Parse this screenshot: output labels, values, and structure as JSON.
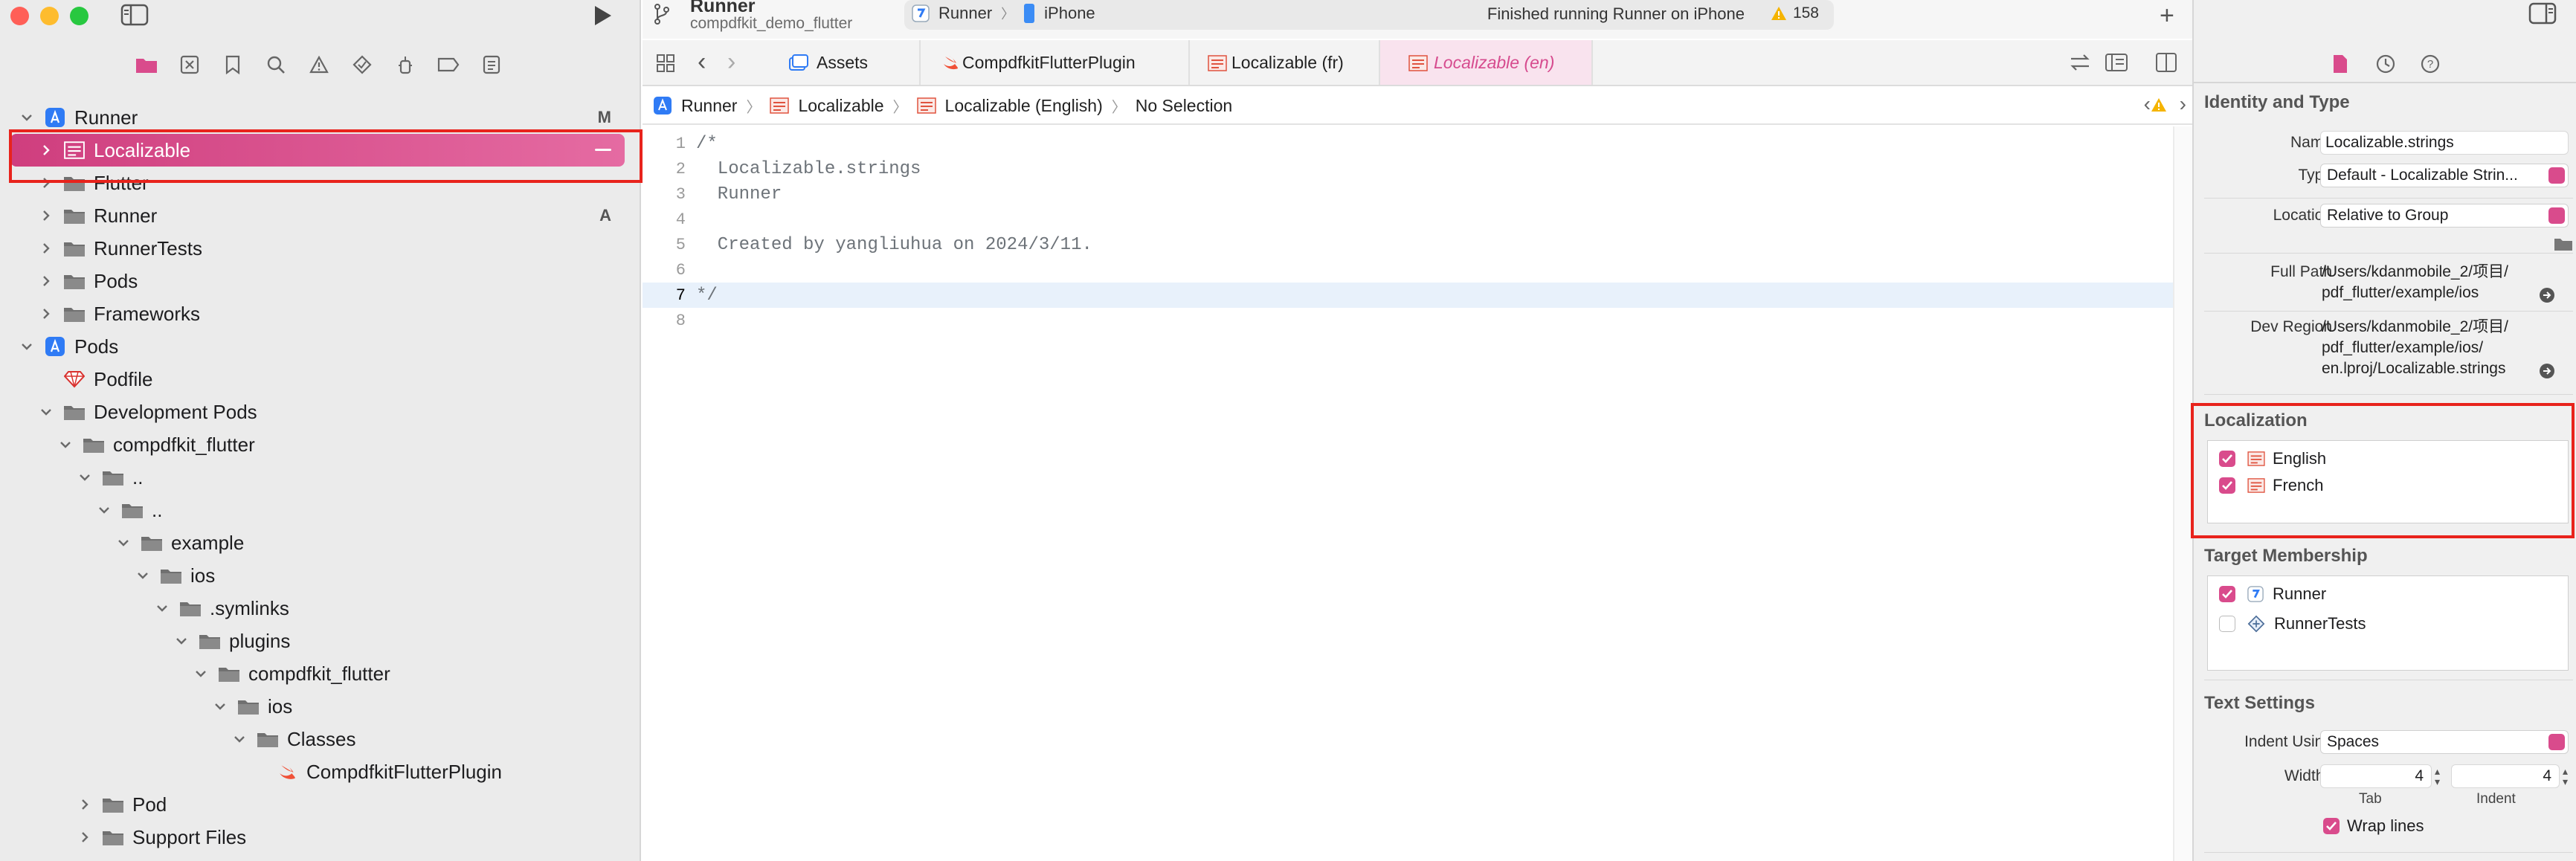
{
  "window": {
    "project_name": "Runner",
    "project_subtitle": "compdfkit_demo_flutter",
    "scheme": "Runner",
    "destination": "iPhone",
    "status": "Finished running Runner on iPhone",
    "warning_count": "158"
  },
  "navigator": {
    "rows": [
      {
        "label": "Runner",
        "badge": "M",
        "icon": "project-icon",
        "indent": 0,
        "chevron": "down"
      },
      {
        "label": "Localizable",
        "badge": "",
        "icon": "strings-file-icon",
        "indent": 1,
        "chevron": "right",
        "selected": true
      },
      {
        "label": "Flutter",
        "badge": "",
        "icon": "folder-icon",
        "indent": 1,
        "chevron": "right"
      },
      {
        "label": "Runner",
        "badge": "A",
        "icon": "folder-icon",
        "indent": 1,
        "chevron": "right"
      },
      {
        "label": "RunnerTests",
        "badge": "",
        "icon": "folder-icon",
        "indent": 1,
        "chevron": "right"
      },
      {
        "label": "Pods",
        "badge": "",
        "icon": "folder-icon",
        "indent": 1,
        "chevron": "right"
      },
      {
        "label": "Frameworks",
        "badge": "",
        "icon": "folder-icon",
        "indent": 1,
        "chevron": "right"
      },
      {
        "label": "Pods",
        "badge": "",
        "icon": "project-icon",
        "indent": 0,
        "chevron": "down"
      },
      {
        "label": "Podfile",
        "badge": "",
        "icon": "ruby-icon",
        "indent": 1,
        "chevron": "none"
      },
      {
        "label": "Development Pods",
        "badge": "",
        "icon": "folder-icon",
        "indent": 1,
        "chevron": "down"
      },
      {
        "label": "compdfkit_flutter",
        "badge": "",
        "icon": "folder-icon",
        "indent": 2,
        "chevron": "down"
      },
      {
        "label": "..",
        "badge": "",
        "icon": "folder-icon",
        "indent": 3,
        "chevron": "down"
      },
      {
        "label": "..",
        "badge": "",
        "icon": "folder-icon",
        "indent": 4,
        "chevron": "down"
      },
      {
        "label": "example",
        "badge": "",
        "icon": "folder-icon",
        "indent": 5,
        "chevron": "down"
      },
      {
        "label": "ios",
        "badge": "",
        "icon": "folder-icon",
        "indent": 6,
        "chevron": "down"
      },
      {
        "label": ".symlinks",
        "badge": "",
        "icon": "folder-icon",
        "indent": 7,
        "chevron": "down"
      },
      {
        "label": "plugins",
        "badge": "",
        "icon": "folder-icon",
        "indent": 8,
        "chevron": "down"
      },
      {
        "label": "compdfkit_flutter",
        "badge": "",
        "icon": "folder-icon",
        "indent": 9,
        "chevron": "down"
      },
      {
        "label": "ios",
        "badge": "",
        "icon": "folder-icon",
        "indent": 10,
        "chevron": "down"
      },
      {
        "label": "Classes",
        "badge": "",
        "icon": "folder-icon",
        "indent": 11,
        "chevron": "down"
      },
      {
        "label": "CompdfkitFlutterPlugin",
        "badge": "",
        "icon": "swift-icon",
        "indent": 12,
        "chevron": "none"
      },
      {
        "label": "Pod",
        "badge": "",
        "icon": "folder-icon",
        "indent": 3,
        "chevron": "right"
      },
      {
        "label": "Support Files",
        "badge": "",
        "icon": "folder-icon",
        "indent": 3,
        "chevron": "right"
      }
    ]
  },
  "editor": {
    "tabs": [
      "Assets",
      "CompdfkitFlutterPlugin",
      "Localizable (fr)",
      "Localizable (en)"
    ],
    "breadcrumb": [
      "Runner",
      "Localizable",
      "Localizable (English)",
      "No Selection"
    ],
    "lines": [
      {
        "n": "1",
        "text": "/*"
      },
      {
        "n": "2",
        "text": "  Localizable.strings"
      },
      {
        "n": "3",
        "text": "  Runner"
      },
      {
        "n": "4",
        "text": ""
      },
      {
        "n": "5",
        "text": "  Created by yangliuhua on 2024/3/11."
      },
      {
        "n": "6",
        "text": ""
      },
      {
        "n": "7",
        "text": "*/",
        "current": true
      },
      {
        "n": "8",
        "text": ""
      }
    ]
  },
  "inspector": {
    "identity_title": "Identity and Type",
    "name_label": "Name",
    "name_value": "Localizable.strings",
    "type_label": "Type",
    "type_value": "Default - Localizable Strin...",
    "location_label": "Location",
    "location_value": "Relative to Group",
    "fullpath_label": "Full Path",
    "fullpath_line1": "/Users/kdanmobile_2/项目/",
    "fullpath_line2": "pdf_flutter/example/ios",
    "devregion_label": "Dev Region",
    "devregion_line1": "/Users/kdanmobile_2/项目/",
    "devregion_line2": "pdf_flutter/example/ios/",
    "devregion_line3": "en.lproj/Localizable.strings",
    "localization_title": "Localization",
    "localizations": [
      {
        "label": "English",
        "checked": true
      },
      {
        "label": "French",
        "checked": true
      }
    ],
    "membership_title": "Target Membership",
    "targets": [
      {
        "label": "Runner",
        "checked": true
      },
      {
        "label": "RunnerTests",
        "checked": false
      }
    ],
    "text_settings_title": "Text Settings",
    "indent_using_label": "Indent Using",
    "indent_using_value": "Spaces",
    "widths_label": "Widths",
    "tab_width": "4",
    "indent_width": "4",
    "tab_caption": "Tab",
    "indent_caption": "Indent",
    "wrap_lines_label": "Wrap lines",
    "wrap_lines": true
  },
  "colors": {
    "accent": "#d94b8c",
    "selection_start": "#cf3e7e",
    "selection_end": "#e56ba2",
    "highlight_box": "#e8231c",
    "folder": "#6f6f6f",
    "project": "#2f7bf5"
  }
}
